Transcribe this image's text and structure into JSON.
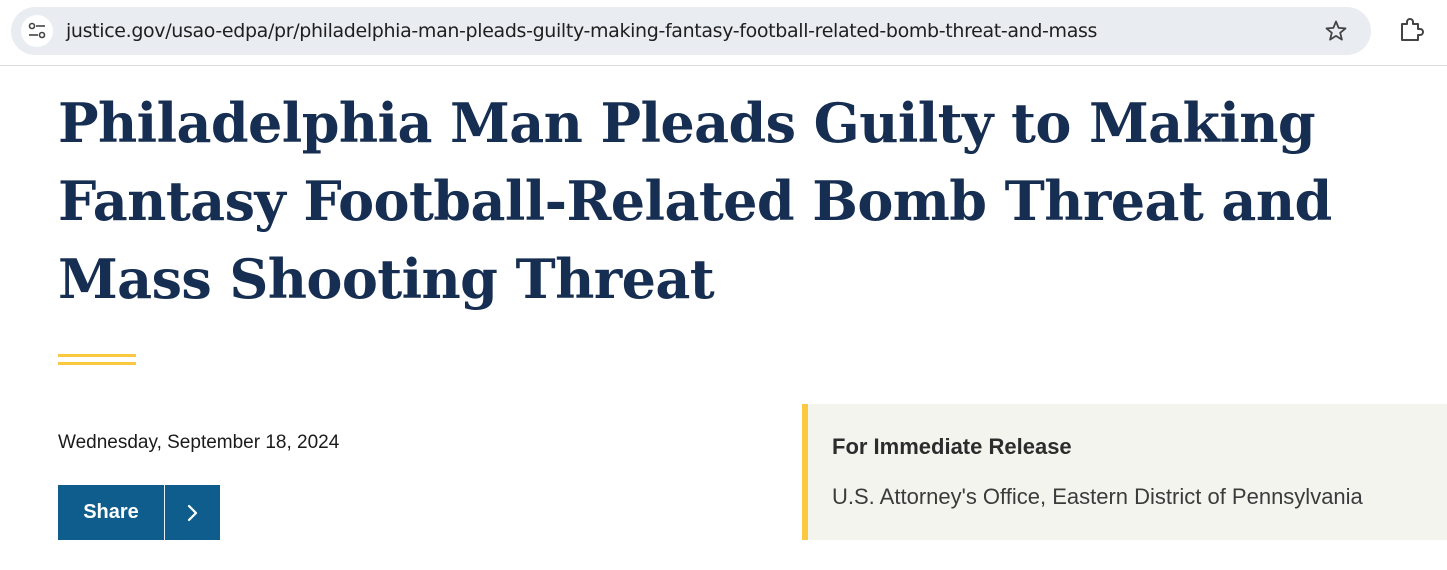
{
  "browser": {
    "url": "justice.gov/usao-edpa/pr/philadelphia-man-pleads-guilty-making-fantasy-football-related-bomb-threat-and-mass",
    "icons": [
      "site-info-icon",
      "star-icon",
      "extensions-icon"
    ]
  },
  "article": {
    "title": "Philadelphia Man Pleads Guilty to Making Fantasy Football-Related Bomb Threat and Mass Shooting Threat",
    "date": "Wednesday, September 18, 2024",
    "share_label": "Share"
  },
  "release": {
    "heading": "For Immediate Release",
    "office": "U.S. Attorney's Office, Eastern District of Pennsylvania"
  },
  "colors": {
    "title": "#162e51",
    "accent": "#fac93f",
    "share_button": "#0f5d8c",
    "release_background": "#f4f4ef"
  }
}
